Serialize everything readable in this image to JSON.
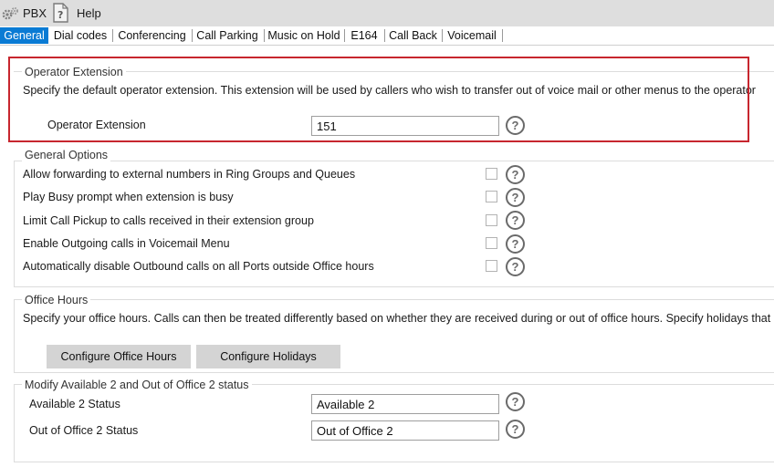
{
  "menubar": {
    "settings_icon": "gears-icon",
    "pbx_label": "PBX",
    "help_icon": "help-document-icon",
    "help_label": "Help"
  },
  "tabs": [
    {
      "label": "General",
      "active": true
    },
    {
      "label": "Dial codes"
    },
    {
      "label": "Conferencing"
    },
    {
      "label": "Call Parking"
    },
    {
      "label": "Music on Hold"
    },
    {
      "label": "E164"
    },
    {
      "label": "Call Back"
    },
    {
      "label": "Voicemail"
    }
  ],
  "operator": {
    "title": "Operator Extension",
    "description": "Specify the default operator extension. This extension will be used by callers who wish to transfer out of voice mail or other menus to the operator",
    "field_label": "Operator Extension",
    "field_value": "151"
  },
  "general_options": {
    "title": "General Options",
    "items": [
      {
        "label": "Allow forwarding to external numbers in Ring Groups and Queues",
        "checked": false
      },
      {
        "label": "Play Busy prompt when extension is busy",
        "checked": false
      },
      {
        "label": "Limit Call Pickup to calls received in their extension group",
        "checked": false
      },
      {
        "label": "Enable Outgoing calls in Voicemail Menu",
        "checked": false
      },
      {
        "label": "Automatically disable Outbound calls on all Ports outside Office hours",
        "checked": false
      }
    ]
  },
  "office_hours": {
    "title": "Office Hours",
    "description": "Specify your office hours. Calls can then be treated differently based on whether they are received during or out of office hours. Specify holidays that are to",
    "configure_hours_label": "Configure Office Hours",
    "configure_holidays_label": "Configure Holidays"
  },
  "status": {
    "title": "Modify Available 2 and Out of Office 2 status",
    "available_label": "Available 2 Status",
    "available_value": "Available 2",
    "out_of_office_label": "Out of Office 2 Status",
    "out_of_office_value": "Out of Office 2"
  },
  "help_glyph": "?",
  "colors": {
    "accent": "#0a7bd4",
    "highlight": "#c7262e",
    "menubar_bg": "#dedede",
    "button_bg": "#d4d4d4"
  }
}
